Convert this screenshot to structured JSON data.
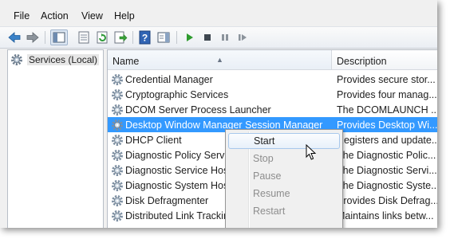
{
  "menubar": {
    "file": "File",
    "action": "Action",
    "view": "View",
    "help": "Help"
  },
  "toolbar": {
    "icons": [
      "back-arrow-icon",
      "forward-arrow-icon",
      "show-hide-console-tree-icon",
      "properties-icon",
      "refresh-icon",
      "export-list-icon",
      "help-icon",
      "show-action-pane-icon",
      "start-service-icon",
      "stop-service-icon",
      "pause-service-icon",
      "restart-service-icon"
    ]
  },
  "tree": {
    "root_label": "Services (Local)"
  },
  "table": {
    "headers": {
      "name": "Name",
      "description": "Description"
    },
    "rows": [
      {
        "name": "Credential Manager",
        "description": "Provides secure stor..."
      },
      {
        "name": "Cryptographic Services",
        "description": "Provides four manag..."
      },
      {
        "name": "DCOM Server Process Launcher",
        "description": "The DCOMLAUNCH ..."
      },
      {
        "name": "Desktop Window Manager Session Manager",
        "description": "Provides Desktop Wi...",
        "selected": true
      },
      {
        "name": "DHCP Client",
        "description": "Registers and update..."
      },
      {
        "name": "Diagnostic Policy Service",
        "description": "The Diagnostic Polic..."
      },
      {
        "name": "Diagnostic Service Host",
        "description": "The Diagnostic Servi..."
      },
      {
        "name": "Diagnostic System Host",
        "description": "The Diagnostic Syste..."
      },
      {
        "name": "Disk Defragmenter",
        "description": "Provides Disk Defrag..."
      },
      {
        "name": "Distributed Link Tracking Client",
        "description": "Maintains links betw..."
      }
    ]
  },
  "context_menu": {
    "items": [
      {
        "label": "Start",
        "enabled": true,
        "hover": true
      },
      {
        "label": "Stop",
        "enabled": false
      },
      {
        "label": "Pause",
        "enabled": false
      },
      {
        "label": "Resume",
        "enabled": false
      },
      {
        "label": "Restart",
        "enabled": false
      }
    ]
  },
  "colors": {
    "selection": "#3399ff",
    "toolbar_green": "#2e9b2e"
  }
}
